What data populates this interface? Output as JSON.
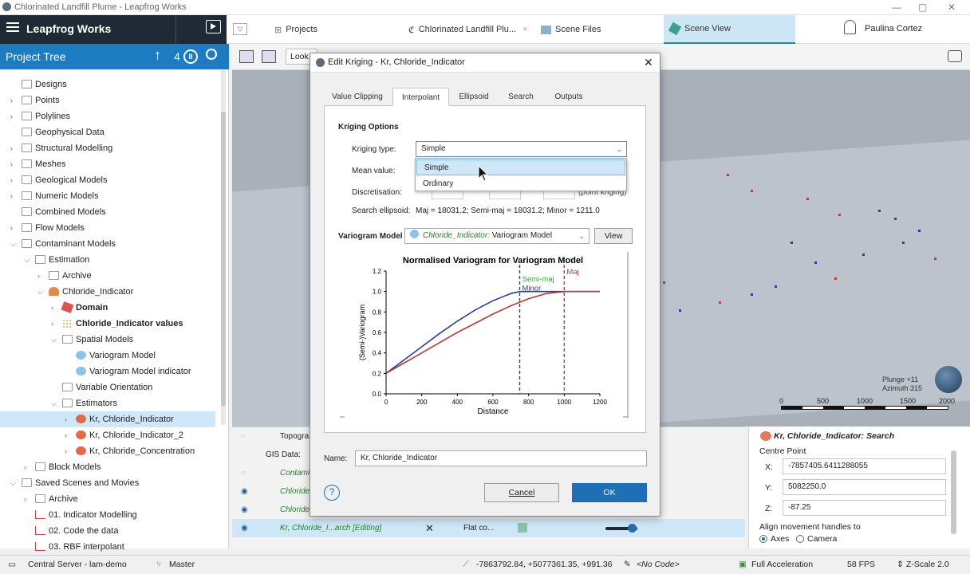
{
  "window": {
    "title": "Chlorinated Landfill Plume - Leapfrog Works"
  },
  "topnav": {
    "brand": "Leapfrog Works",
    "tabs": [
      "Projects",
      "Chlorinated Landfill Plu...",
      "Scene Files",
      "Scene View"
    ],
    "user": "Paulina Cortez"
  },
  "project_tree": {
    "title": "Project Tree",
    "count": "4",
    "items": [
      "Designs",
      "Points",
      "Polylines",
      "Geophysical Data",
      "Structural Modelling",
      "Meshes",
      "Geological Models",
      "Numeric Models",
      "Combined Models",
      "Flow Models",
      "Contaminant Models",
      "Estimation",
      "Archive",
      "Chloride_Indicator",
      "Domain",
      "Chloride_Indicator values",
      "Spatial Models",
      "Variogram Model",
      "Variogram Model indicator",
      "Variable Orientation",
      "Estimators",
      "Kr, Chloride_Indicator",
      "Kr, Chloride_Indicator_2",
      "Kr, Chloride_Concentration",
      "Block Models",
      "Saved Scenes and Movies",
      "Archive",
      "01. Indicator Modelling",
      "02. Code the data",
      "03. RBF interpolant"
    ]
  },
  "toolbar": {
    "look": "Look"
  },
  "dialog": {
    "title": "Edit Kriging - Kr, Chloride_Indicator",
    "tabs": [
      "Value Clipping",
      "Interpolant",
      "Ellipsoid",
      "Search",
      "Outputs"
    ],
    "section": "Kriging Options",
    "kriging_type_label": "Kriging type:",
    "kriging_type_value": "Simple",
    "options": [
      "Simple",
      "Ordinary"
    ],
    "mean_value_label": "Mean value:",
    "discretisation_label": "Discretisation:",
    "disc_hint": "(point kriging)",
    "search_ellipsoid_label": "Search ellipsoid:",
    "search_ellipsoid_value": "Maj = 18031.2; Semi-maj = 18031.2; Minor = 1211.0",
    "variogram_label": "Variogram Model",
    "variogram_value_em": "Chloride_Indicator:",
    "variogram_value": " Variogram Model",
    "view": "View",
    "name_label": "Name:",
    "name_value": "Kr, Chloride_Indicator",
    "cancel": "Cancel",
    "ok": "OK",
    "help": "?"
  },
  "chart_data": {
    "type": "line",
    "title": "Normalised Variogram for Variogram Model",
    "xlabel": "Distance",
    "ylabel": "(Semi-)Variogram",
    "xlim": [
      0,
      1200
    ],
    "ylim": [
      0,
      1.2
    ],
    "xticks": [
      "0",
      "200",
      "400",
      "600",
      "800",
      "1000",
      "1200"
    ],
    "yticks": [
      "0.0",
      "0.2",
      "0.4",
      "0.6",
      "0.8",
      "1.0",
      "1.2"
    ],
    "series": [
      {
        "name": "Semi-maj",
        "color": "#2b3d9a",
        "x": [
          0,
          100,
          200,
          300,
          400,
          500,
          600,
          700,
          750,
          1000,
          1200
        ],
        "y": [
          0.2,
          0.33,
          0.46,
          0.59,
          0.71,
          0.82,
          0.91,
          0.98,
          1.0,
          1.0,
          1.0
        ]
      },
      {
        "name": "Maj",
        "color": "#b33a3a",
        "x": [
          0,
          100,
          200,
          300,
          400,
          500,
          600,
          700,
          800,
          900,
          1000,
          1200
        ],
        "y": [
          0.2,
          0.3,
          0.4,
          0.5,
          0.6,
          0.69,
          0.78,
          0.86,
          0.93,
          0.98,
          1.0,
          1.0
        ]
      }
    ],
    "vlines": [
      {
        "x": 750,
        "color": "#2b3d9a",
        "label": "Minor"
      },
      {
        "x": 1000,
        "color": "#b33a3a",
        "label": "Maj"
      }
    ],
    "annotations": [
      "Semi-maj",
      "Minor",
      "Maj"
    ]
  },
  "bottom_panel": {
    "rows": [
      "Topogra",
      "GIS Data:",
      "Contami",
      "Chloride",
      "Chloride",
      "Kr, Chloride_I...arch [Editing]"
    ],
    "flat": "Flat co..."
  },
  "right_panel": {
    "title": "Kr, Chloride_Indicator: Search",
    "centre": "Centre Point",
    "x": "-7857405.6411288055",
    "y": "5082250.0",
    "z": "-87.25",
    "align": "Align movement handles to",
    "axes": "Axes",
    "camera": "Camera",
    "xl": "X:",
    "yl": "Y:",
    "zl": "Z:"
  },
  "viewport": {
    "plunge": "Plunge +11",
    "azimuth": "Azimuth 315",
    "scale": [
      "0",
      "500",
      "1000",
      "1500",
      "2000"
    ]
  },
  "status": {
    "server": "Central Server - lam-demo",
    "branch": "Master",
    "coords": "-7863792.84, +5077361.35, +991.36",
    "code": "<No Code>",
    "accel": "Full Acceleration",
    "fps": "58 FPS",
    "zscale": "Z-Scale 2.0"
  }
}
